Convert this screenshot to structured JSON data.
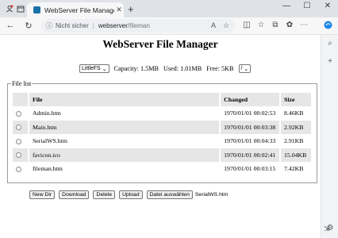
{
  "browser": {
    "tab_title": "WebServer File Manager",
    "new_tab": "+",
    "address": {
      "security_label": "Nicht sicher",
      "host": "webserver",
      "path": "/fileman"
    },
    "window_controls": {
      "minimize": "—",
      "maximize": "☐",
      "close": "✕"
    }
  },
  "page": {
    "title": "WebServer File Manager",
    "fs_select": "LittleFS",
    "capacity": "Capacity: 1.5MB",
    "used": "Used: 1.01MB",
    "free": "Free: 5KB",
    "dir_select": "/",
    "file_list": {
      "legend": "File list",
      "headers": {
        "file": "File",
        "changed": "Changed",
        "size": "Size"
      },
      "rows": [
        {
          "name": "Admin.htm",
          "changed": "1970/01/01 00:02:53",
          "size": "8.46KB"
        },
        {
          "name": "Main.htm",
          "changed": "1970/01/01 00:03:38",
          "size": "2.92KB"
        },
        {
          "name": "SerialWS.htm",
          "changed": "1970/01/01 00:04:33",
          "size": "2.91KB"
        },
        {
          "name": "favicon.ico",
          "changed": "1970/01/01 00:02:41",
          "size": "15.04KB"
        },
        {
          "name": "fileman.htm",
          "changed": "1970/01/01 00:03:15",
          "size": "7.42KB"
        }
      ]
    },
    "buttons": {
      "new_dir": "New Dir",
      "download": "Download",
      "delete": "Delete",
      "upload": "Upload",
      "choose_file": "Datei auswählen"
    },
    "chosen_file": "SerialWS.htm"
  }
}
